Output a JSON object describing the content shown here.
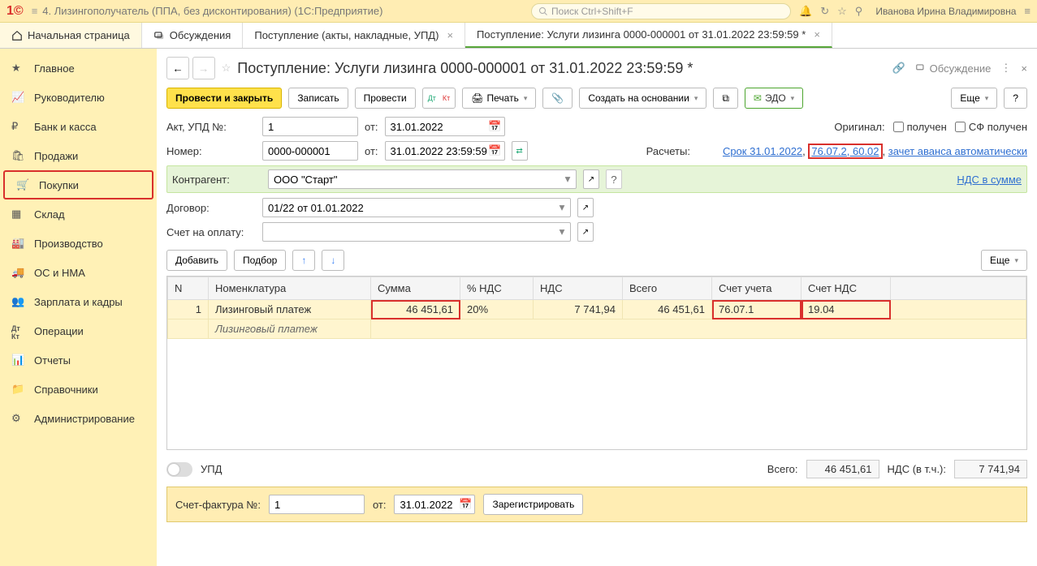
{
  "titlebar": {
    "app_title": "4. Лизингополучатель (ППА, без дисконтирования)  (1С:Предприятие)",
    "search_placeholder": "Поиск Ctrl+Shift+F",
    "user": "Иванова Ирина Владимировна"
  },
  "tabs": {
    "home": "Начальная страница",
    "discuss": "Обсуждения",
    "receipts": "Поступление (акты, накладные, УПД)",
    "current": "Поступление: Услуги лизинга 0000-000001 от 31.01.2022 23:59:59 *"
  },
  "sidebar": {
    "items": [
      "Главное",
      "Руководителю",
      "Банк и касса",
      "Продажи",
      "Покупки",
      "Склад",
      "Производство",
      "ОС и НМА",
      "Зарплата и кадры",
      "Операции",
      "Отчеты",
      "Справочники",
      "Администрирование"
    ]
  },
  "doc": {
    "title": "Поступление: Услуги лизинга 0000-000001 от 31.01.2022 23:59:59 *",
    "discuss": "Обсуждение"
  },
  "toolbar": {
    "post_close": "Провести и закрыть",
    "write": "Записать",
    "post": "Провести",
    "print": "Печать",
    "create_based": "Создать на основании",
    "edo": "ЭДО",
    "more": "Еще"
  },
  "form": {
    "act_lbl": "Акт, УПД №:",
    "act_no": "1",
    "from": "от:",
    "act_date": "31.01.2022",
    "original": "Оригинал:",
    "received": "получен",
    "sf_received": "СФ получен",
    "num_lbl": "Номер:",
    "num": "0000-000001",
    "num_date": "31.01.2022 23:59:59",
    "calc": "Расчеты:",
    "calc_due": "Срок 31.01.2022",
    "calc_acc": "76.07.2, 60.02",
    "calc_adv": "зачет аванса автоматически",
    "nds_link": "НДС в сумме",
    "contractor_lbl": "Контрагент:",
    "contractor": "ООО \"Старт\"",
    "contract_lbl": "Договор:",
    "contract": "01/22 от 01.01.2022",
    "pay_acc_lbl": "Счет на оплату:"
  },
  "tbl_toolbar": {
    "add": "Добавить",
    "pick": "Подбор",
    "more": "Еще"
  },
  "table": {
    "cols": [
      "N",
      "Номенклатура",
      "Сумма",
      "% НДС",
      "НДС",
      "Всего",
      "Счет учета",
      "Счет НДС"
    ],
    "row": {
      "n": "1",
      "name": "Лизинговый платеж",
      "sum": "46 451,61",
      "vat_pct": "20%",
      "vat": "7 741,94",
      "total": "46 451,61",
      "acct": "76.07.1",
      "vat_acct": "19.04",
      "sub": "Лизинговый платеж"
    }
  },
  "footer": {
    "upd": "УПД",
    "total_lbl": "Всего:",
    "total": "46 451,61",
    "vat_lbl": "НДС (в т.ч.):",
    "vat": "7 741,94"
  },
  "invoice": {
    "lbl": "Счет-фактура №:",
    "no": "1",
    "from": "от:",
    "date": "31.01.2022",
    "register": "Зарегистрировать"
  }
}
